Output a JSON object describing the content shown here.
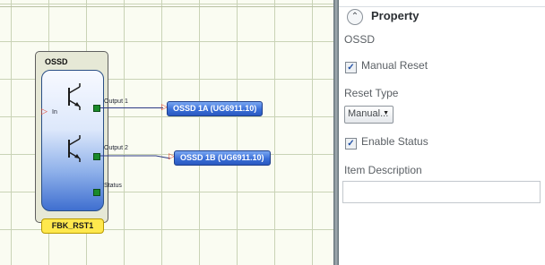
{
  "block": {
    "title": "OSSD",
    "name_tag": "FBK_RST1",
    "input_pin": "In",
    "output_pins": [
      "Output 1",
      "Output 2"
    ],
    "status_pin": "Status"
  },
  "outputs": [
    {
      "label": "OSSD 1A (UG6911.10)"
    },
    {
      "label": "OSSD 1B (UG6911.10)"
    }
  ],
  "panel": {
    "title": "Property",
    "subtitle": "OSSD",
    "manual_reset": {
      "label": "Manual Reset",
      "checked": true
    },
    "reset_type": {
      "label": "Reset Type",
      "value": "Manual..."
    },
    "enable_status": {
      "label": "Enable Status",
      "checked": true
    },
    "item_description": {
      "label": "Item Description",
      "value": ""
    }
  },
  "icons": {
    "collapse": "chevron-up-icon",
    "transistor": "transistor-icon",
    "check": "checkmark-icon"
  },
  "colors": {
    "block_gradient_bottom": "#3f6fd0",
    "output_box": "#3a6fd8",
    "pin": "#1a8a2a",
    "name_tag": "#ffe84d",
    "arrow": "#e0402a",
    "grid": "#c9d3b6"
  }
}
